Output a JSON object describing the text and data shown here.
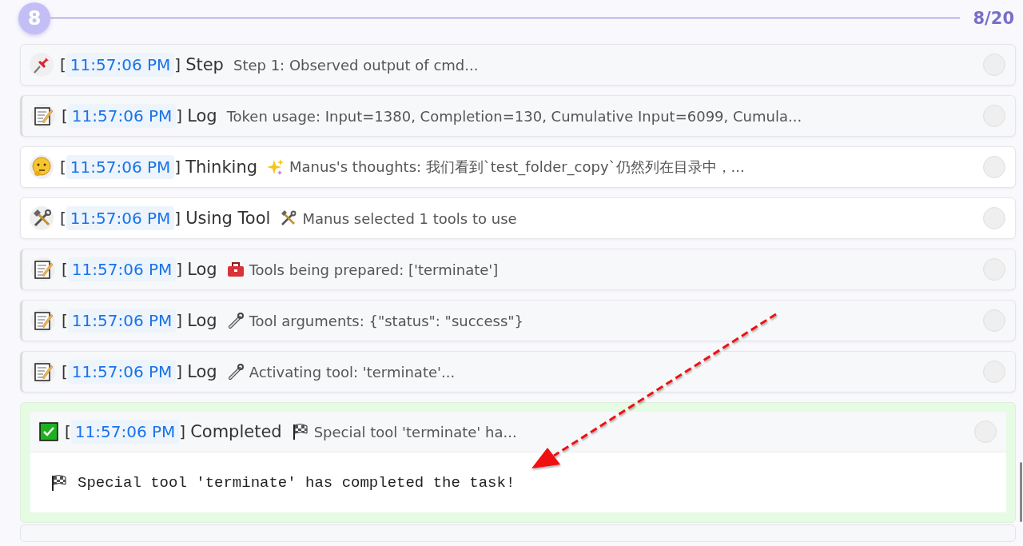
{
  "header": {
    "step_number": "8",
    "progress": "8/20"
  },
  "rows": [
    {
      "kind": "step",
      "open_bracket": "[",
      "time": "11:57:06 PM",
      "close_bracket": "]",
      "label": "Step",
      "message": {
        "kind": "plain",
        "text": "Step 1: Observed output of cmd..."
      },
      "expanded": false
    },
    {
      "kind": "log",
      "open_bracket": "[",
      "time": "11:57:06 PM",
      "close_bracket": "]",
      "label": "Log",
      "message": {
        "kind": "plain",
        "text": "Token usage: Input=1380, Completion=130, Cumulative Input=6099, Cumula..."
      },
      "expanded": false
    },
    {
      "kind": "thinking",
      "open_bracket": "[",
      "time": "11:57:06 PM",
      "close_bracket": "]",
      "label": "Thinking",
      "message": {
        "kind": "thoughts",
        "text": "Manus's thoughts: 我们看到`test_folder_copy`仍然列在目录中，..."
      },
      "expanded": false
    },
    {
      "kind": "tool",
      "open_bracket": "[",
      "time": "11:57:06 PM",
      "close_bracket": "]",
      "label": "Using Tool",
      "message": {
        "kind": "selection",
        "text": "Manus selected 1 tools to use"
      },
      "expanded": false
    },
    {
      "kind": "log",
      "open_bracket": "[",
      "time": "11:57:06 PM",
      "close_bracket": "]",
      "label": "Log",
      "message": {
        "kind": "preparation",
        "text": "Tools being prepared: ['terminate']"
      },
      "expanded": false
    },
    {
      "kind": "log",
      "open_bracket": "[",
      "time": "11:57:06 PM",
      "close_bracket": "]",
      "label": "Log",
      "message": {
        "kind": "arguments",
        "text": "Tool arguments: {\"status\": \"success\"}"
      },
      "expanded": false
    },
    {
      "kind": "log",
      "open_bracket": "[",
      "time": "11:57:06 PM",
      "close_bracket": "]",
      "label": "Log",
      "message": {
        "kind": "activation",
        "text": "Activating tool: 'terminate'..."
      },
      "expanded": false
    },
    {
      "kind": "completed",
      "open_bracket": "[",
      "time": "11:57:06 PM",
      "close_bracket": "]",
      "label": "Completed",
      "message": {
        "kind": "special",
        "text": "Special tool 'terminate' ha..."
      },
      "expanded": true,
      "body": {
        "kind": "special",
        "text": "Special tool 'terminate' has completed the task!"
      }
    }
  ]
}
